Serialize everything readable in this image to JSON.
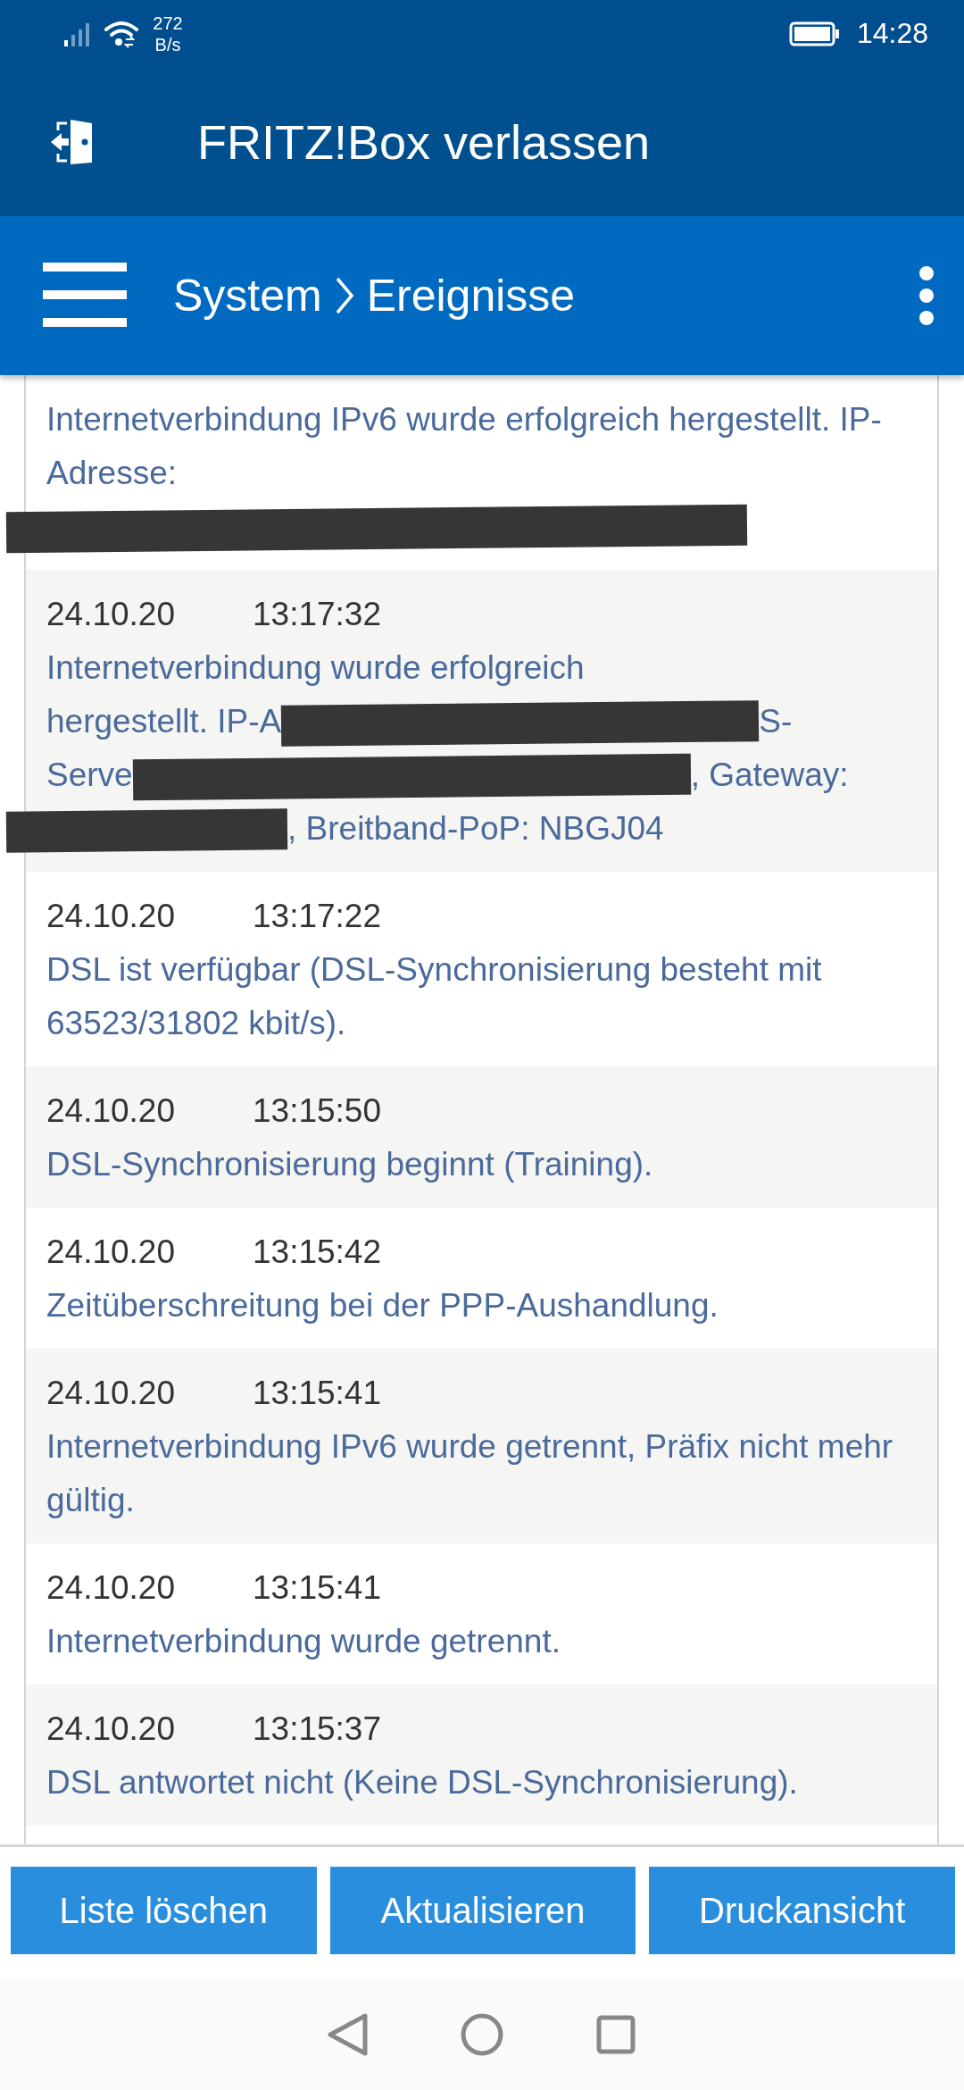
{
  "status_bar": {
    "network_speed": "272 B/s",
    "time": "14:28"
  },
  "header": {
    "title": "FRITZ!Box verlassen"
  },
  "nav_bar": {
    "breadcrumb": [
      "System",
      "Ereignisse"
    ]
  },
  "events": [
    {
      "segments": [
        {
          "kind": "text",
          "text": "Internetverbindung IPv6 wurde erfolgreich hergestellt. IP-Adresse:"
        },
        {
          "kind": "break"
        },
        {
          "kind": "redaction"
        }
      ]
    },
    {
      "date": "24.10.20",
      "time": "13:17:32",
      "segments": [
        {
          "kind": "text",
          "text": "Internetverbindung wurde erfolgreich"
        },
        {
          "kind": "break"
        },
        {
          "kind": "text",
          "text": "hergestellt. IP-A"
        },
        {
          "kind": "redaction"
        },
        {
          "kind": "text",
          "text": "S-"
        },
        {
          "kind": "break"
        },
        {
          "kind": "text",
          "text": "Serve"
        },
        {
          "kind": "redaction"
        },
        {
          "kind": "text",
          "text": ", Gateway:"
        },
        {
          "kind": "break"
        },
        {
          "kind": "redaction"
        },
        {
          "kind": "text",
          "text": ", Breitband-PoP: NBGJ04"
        }
      ]
    },
    {
      "date": "24.10.20",
      "time": "13:17:22",
      "message": "DSL ist verfügbar (DSL-Synchronisierung besteht mit 63523/31802 kbit/s)."
    },
    {
      "date": "24.10.20",
      "time": "13:15:50",
      "message": "DSL-Synchronisierung beginnt (Training)."
    },
    {
      "date": "24.10.20",
      "time": "13:15:42",
      "message": "Zeitüberschreitung bei der PPP-Aushandlung."
    },
    {
      "date": "24.10.20",
      "time": "13:15:41",
      "message": "Internetverbindung IPv6 wurde getrennt, Präfix nicht mehr gültig."
    },
    {
      "date": "24.10.20",
      "time": "13:15:41",
      "message": "Internetverbindung wurde getrennt."
    },
    {
      "date": "24.10.20",
      "time": "13:15:37",
      "message": "DSL antwortet nicht (Keine DSL-Synchronisierung)."
    }
  ],
  "buttons": [
    "Liste löschen",
    "Aktualisieren",
    "Druckansicht"
  ]
}
